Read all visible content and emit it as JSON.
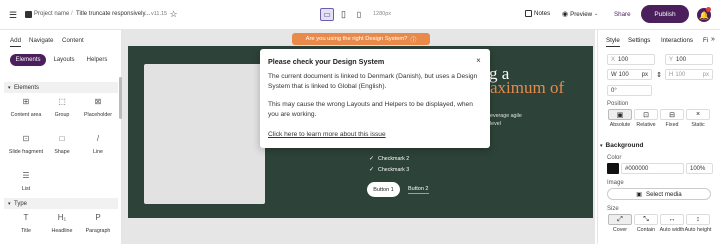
{
  "topbar": {
    "breadcrumb_project": "Project name",
    "breadcrumb_sep": "/",
    "breadcrumb_page": "Title truncate responsively...",
    "version": "v11.15",
    "viewport_size": "1280px",
    "notes": "Notes",
    "preview": "Preview",
    "share": "Share",
    "publish": "Publish"
  },
  "left": {
    "tabs": [
      "Add",
      "Navigate",
      "Content"
    ],
    "pills": [
      "Elements",
      "Layouts",
      "Helpers"
    ],
    "section_elements": "Elements",
    "section_type": "Type",
    "items": [
      {
        "label": "Content area",
        "glyph": "⊞"
      },
      {
        "label": "Group",
        "glyph": "⬚"
      },
      {
        "label": "Placeholder",
        "glyph": "⊠"
      },
      {
        "label": "Slide fragment",
        "glyph": "⊡"
      },
      {
        "label": "Shape",
        "glyph": "□"
      },
      {
        "label": "Line",
        "glyph": "/"
      },
      {
        "label": "List",
        "glyph": "☰"
      }
    ],
    "type_items": [
      {
        "label": "Title",
        "glyph": "T"
      },
      {
        "label": "Headline",
        "glyph": "H₁"
      },
      {
        "label": "Paragraph",
        "glyph": "P"
      }
    ]
  },
  "canvas": {
    "banner": "Are you using the right Design System?",
    "heading_1": "g a",
    "heading_2": "aximum of",
    "text_1": "everage agile",
    "text_2": "level",
    "checks": [
      "Checkmark 2",
      "Checkmark 3"
    ],
    "button1": "Button 1",
    "button2": "Button 2"
  },
  "modal": {
    "title": "Please check your Design System",
    "p1": "The current document is linked to Denmark (Danish), but uses a Design System that is linked to Global (English).",
    "p2": "This may cause the wrong Layouts and Helpers to be displayed, when you are working.",
    "link": "Click here to learn more about this issue"
  },
  "right": {
    "tabs": [
      "Style",
      "Settings",
      "Interactions",
      "Fi"
    ],
    "x_label": "X",
    "x": "100",
    "y_label": "Y",
    "y": "100",
    "w_label": "W",
    "w": "100",
    "w_unit": "px",
    "h_label": "H",
    "h": "100",
    "h_unit": "px",
    "rot": "0",
    "rot_unit": "°",
    "position_label": "Position",
    "positions": [
      "Absolute",
      "Relative",
      "Fixed",
      "Static"
    ],
    "background": "Background",
    "color_label": "Color",
    "color_hex": "#000000",
    "opacity": "100%",
    "image_label": "Image",
    "select_media": "Select media",
    "size_label": "Size",
    "sizes": [
      "Cover",
      "Contain",
      "Auto width",
      "Auto height"
    ]
  },
  "colors": {
    "accent": "#4a1f5c",
    "hero": "#2d4238",
    "orange": "#e98a4a"
  }
}
